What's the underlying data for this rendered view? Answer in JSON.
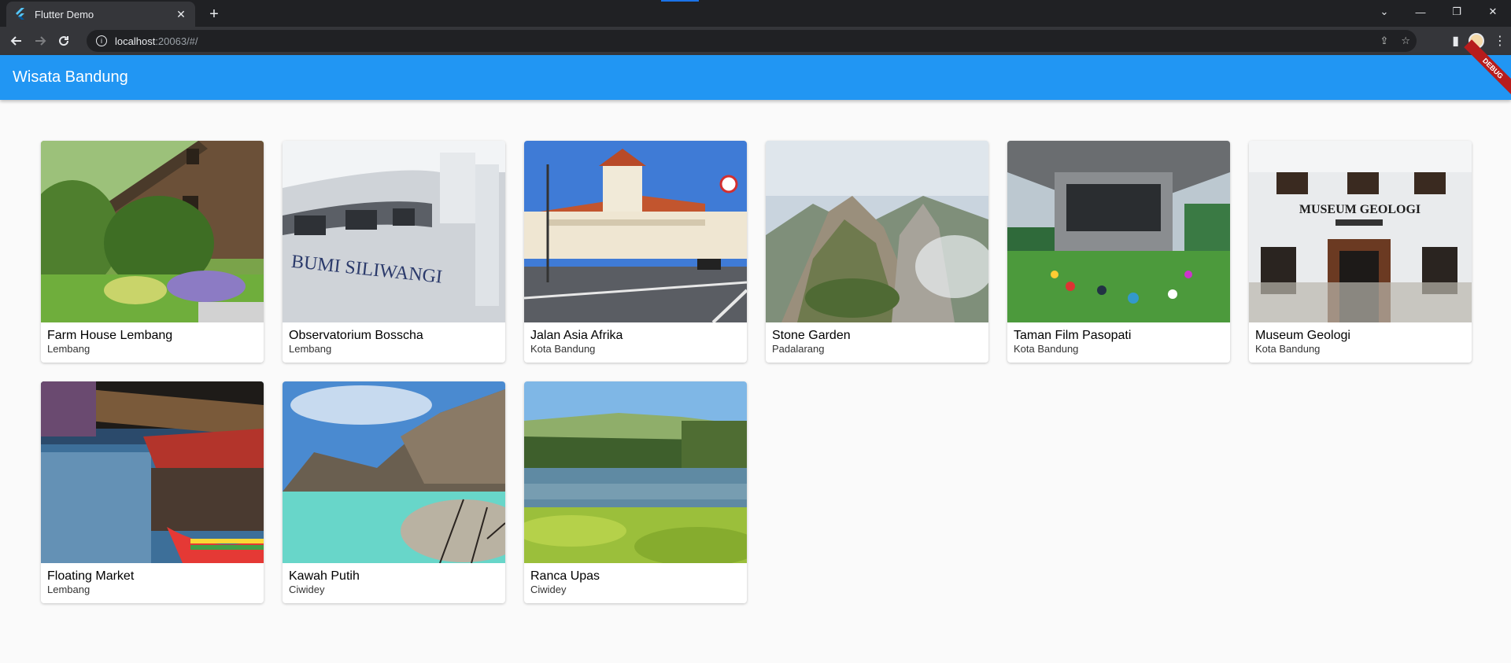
{
  "browser": {
    "tab_title": "Flutter Demo",
    "url_host": "localhost",
    "url_path": ":20063/#/"
  },
  "app": {
    "title": "Wisata Bandung",
    "debug_label": "DEBUG",
    "appbar_color": "#2196F3"
  },
  "places": [
    {
      "name": "Farm House Lembang",
      "location": "Lembang"
    },
    {
      "name": "Observatorium Bosscha",
      "location": "Lembang"
    },
    {
      "name": "Jalan Asia Afrika",
      "location": "Kota Bandung"
    },
    {
      "name": "Stone Garden",
      "location": "Padalarang"
    },
    {
      "name": "Taman Film Pasopati",
      "location": "Kota Bandung"
    },
    {
      "name": "Museum Geologi",
      "location": "Kota Bandung"
    },
    {
      "name": "Floating Market",
      "location": "Lembang"
    },
    {
      "name": "Kawah Putih",
      "location": "Ciwidey"
    },
    {
      "name": "Ranca Upas",
      "location": "Ciwidey"
    }
  ],
  "image_text": {
    "bosscha_sign": "BUMI SILIWANGI",
    "museum_sign": "MUSEUM GEOLOGI"
  }
}
